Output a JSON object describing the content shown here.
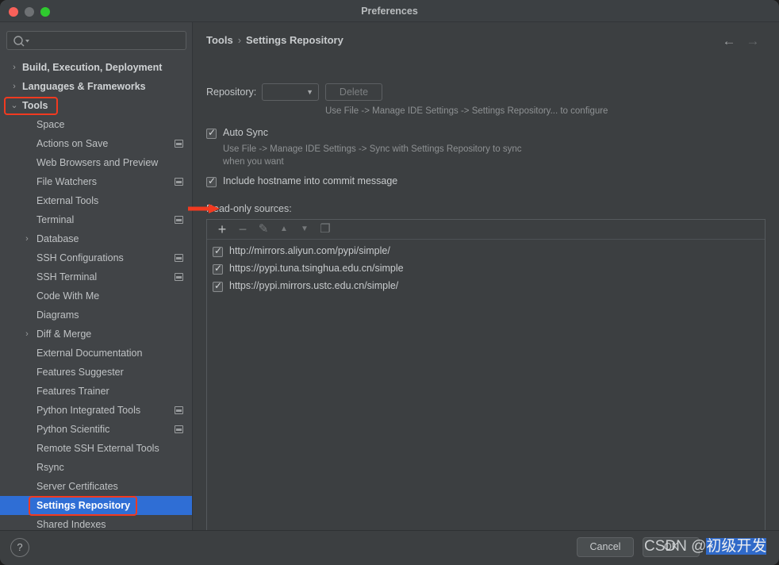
{
  "window": {
    "title": "Preferences",
    "controls": {
      "close": "close-button",
      "minimize": "minimize-button",
      "maximize": "maximize-button"
    }
  },
  "sidebar": {
    "search": {
      "value": "",
      "placeholder": ""
    },
    "items": [
      {
        "label": "Build, Execution, Deployment",
        "level": 0,
        "arrow": "›",
        "expanded": false,
        "selected": false,
        "proj": false
      },
      {
        "label": "Languages & Frameworks",
        "level": 0,
        "arrow": "›",
        "expanded": false,
        "selected": false,
        "proj": false
      },
      {
        "label": "Tools",
        "level": 0,
        "arrow": "⌄",
        "expanded": true,
        "selected": false,
        "proj": false
      },
      {
        "label": "Space",
        "level": 1,
        "arrow": "",
        "selected": false,
        "proj": false
      },
      {
        "label": "Actions on Save",
        "level": 1,
        "arrow": "",
        "selected": false,
        "proj": true
      },
      {
        "label": "Web Browsers and Preview",
        "level": 1,
        "arrow": "",
        "selected": false,
        "proj": false
      },
      {
        "label": "File Watchers",
        "level": 1,
        "arrow": "",
        "selected": false,
        "proj": true
      },
      {
        "label": "External Tools",
        "level": 1,
        "arrow": "",
        "selected": false,
        "proj": false
      },
      {
        "label": "Terminal",
        "level": 1,
        "arrow": "",
        "selected": false,
        "proj": true
      },
      {
        "label": "Database",
        "level": 1,
        "arrow": "›",
        "selected": false,
        "proj": false
      },
      {
        "label": "SSH Configurations",
        "level": 1,
        "arrow": "",
        "selected": false,
        "proj": true
      },
      {
        "label": "SSH Terminal",
        "level": 1,
        "arrow": "",
        "selected": false,
        "proj": true
      },
      {
        "label": "Code With Me",
        "level": 1,
        "arrow": "",
        "selected": false,
        "proj": false
      },
      {
        "label": "Diagrams",
        "level": 1,
        "arrow": "",
        "selected": false,
        "proj": false
      },
      {
        "label": "Diff & Merge",
        "level": 1,
        "arrow": "›",
        "selected": false,
        "proj": false
      },
      {
        "label": "External Documentation",
        "level": 1,
        "arrow": "",
        "selected": false,
        "proj": false
      },
      {
        "label": "Features Suggester",
        "level": 1,
        "arrow": "",
        "selected": false,
        "proj": false
      },
      {
        "label": "Features Trainer",
        "level": 1,
        "arrow": "",
        "selected": false,
        "proj": false
      },
      {
        "label": "Python Integrated Tools",
        "level": 1,
        "arrow": "",
        "selected": false,
        "proj": true
      },
      {
        "label": "Python Scientific",
        "level": 1,
        "arrow": "",
        "selected": false,
        "proj": true
      },
      {
        "label": "Remote SSH External Tools",
        "level": 1,
        "arrow": "",
        "selected": false,
        "proj": false
      },
      {
        "label": "Rsync",
        "level": 1,
        "arrow": "",
        "selected": false,
        "proj": false
      },
      {
        "label": "Server Certificates",
        "level": 1,
        "arrow": "",
        "selected": false,
        "proj": false
      },
      {
        "label": "Settings Repository",
        "level": 1,
        "arrow": "",
        "selected": true,
        "proj": false
      },
      {
        "label": "Shared Indexes",
        "level": 1,
        "arrow": "",
        "selected": false,
        "proj": false
      }
    ]
  },
  "main": {
    "breadcrumb": {
      "parent": "Tools",
      "separator": "›",
      "current": "Settings Repository"
    },
    "nav": {
      "back": "←",
      "forward": "→"
    },
    "repository": {
      "label": "Repository:",
      "selected_value": "",
      "chevron": "▼",
      "delete_label": "Delete",
      "hint": "Use File -> Manage IDE Settings -> Settings Repository... to configure"
    },
    "auto_sync": {
      "label": "Auto Sync",
      "checked": true,
      "tick": "✓",
      "hint": "Use File -> Manage IDE Settings -> Sync with Settings Repository to sync when you want"
    },
    "include_hostname": {
      "label": "Include hostname into commit message",
      "checked": true,
      "tick": "✓"
    },
    "read_only_sources": {
      "label": "Read-only sources:",
      "toolbar": [
        {
          "name": "add-button",
          "glyph": "+",
          "enabled": true
        },
        {
          "name": "remove-button",
          "glyph": "−",
          "enabled": false
        },
        {
          "name": "edit-button",
          "glyph": "✎",
          "enabled": false
        },
        {
          "name": "move-up-button",
          "glyph": "▲",
          "enabled": false
        },
        {
          "name": "move-down-button",
          "glyph": "▼",
          "enabled": false
        },
        {
          "name": "copy-button",
          "glyph": "❐",
          "enabled": false
        }
      ],
      "items": [
        {
          "url": "http://mirrors.aliyun.com/pypi/simple/",
          "checked": true,
          "tick": "✓"
        },
        {
          "url": "https://pypi.tuna.tsinghua.edu.cn/simple",
          "checked": true,
          "tick": "✓"
        },
        {
          "url": "https://pypi.mirrors.ustc.edu.cn/simple/",
          "checked": true,
          "tick": "✓"
        }
      ]
    }
  },
  "footer": {
    "help": "?",
    "cancel_label": "Cancel",
    "ok_label": "OK"
  },
  "watermark": {
    "prefix": "CSDN @",
    "highlighted": "初级开发"
  },
  "colors": {
    "selection_blue": "#2f6ed5",
    "annotation_red": "#f23a20",
    "panel_bg": "#3c3f41",
    "sidebar_bg": "#414447",
    "text": "#c8cbcd",
    "muted_text": "#8e9193"
  }
}
